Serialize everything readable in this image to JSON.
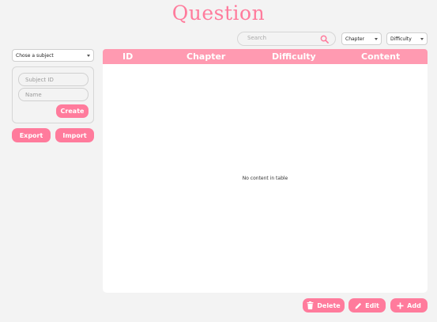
{
  "header": {
    "title": "Question"
  },
  "filters": {
    "search_placeholder": "Search",
    "chapter_label": "Chapter",
    "difficulty_label": "Difficulty"
  },
  "sidebar": {
    "subject_select": "Chose a subject",
    "subject_id_placeholder": "Subject ID",
    "name_placeholder": "Name",
    "create_label": "Create",
    "export_label": "Export",
    "import_label": "Import"
  },
  "table": {
    "columns": [
      "ID",
      "Chapter",
      "Difficulty",
      "Content"
    ],
    "empty_text": "No content in table"
  },
  "actions": {
    "delete_label": "Delete",
    "edit_label": "Edit",
    "add_label": "Add"
  },
  "colors": {
    "accent": "#ff7b9c",
    "header": "#ff9ab1",
    "background": "#f3f3f3"
  },
  "icons": [
    "search-icon",
    "trash-icon",
    "pencil-icon",
    "plus-icon",
    "chevron-down-icon"
  ]
}
